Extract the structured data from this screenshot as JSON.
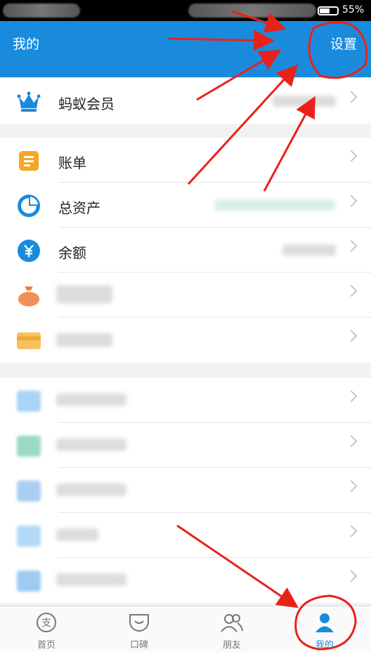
{
  "status_bar": {
    "battery": "55%"
  },
  "header": {
    "title": "我的",
    "settings": "设置"
  },
  "menu_groups": [
    {
      "items": [
        {
          "label": "蚂蚁会员",
          "icon": "crown-icon"
        }
      ]
    },
    {
      "items": [
        {
          "label": "账单",
          "icon": "bill-icon"
        },
        {
          "label": "总资产",
          "icon": "pie-chart-icon"
        },
        {
          "label": "余额",
          "icon": "yuan-icon"
        },
        {
          "label": "",
          "icon": "money-bag-icon"
        },
        {
          "label": "",
          "icon": "card-icon"
        }
      ]
    },
    {
      "items": [
        {
          "label": "",
          "icon": "app-icon"
        },
        {
          "label": "",
          "icon": "app-icon"
        },
        {
          "label": "",
          "icon": "app-icon"
        },
        {
          "label": "",
          "icon": "app-icon"
        },
        {
          "label": "",
          "icon": "app-icon"
        }
      ]
    }
  ],
  "tabbar": [
    {
      "label": "首页",
      "icon": "home-pay-icon"
    },
    {
      "label": "口碑",
      "icon": "koubei-icon"
    },
    {
      "label": "朋友",
      "icon": "friends-icon"
    },
    {
      "label": "我的",
      "icon": "profile-icon"
    }
  ],
  "colors": {
    "primary": "#1a8bdc",
    "annotation": "#e8221b",
    "orange": "#f5a623"
  }
}
